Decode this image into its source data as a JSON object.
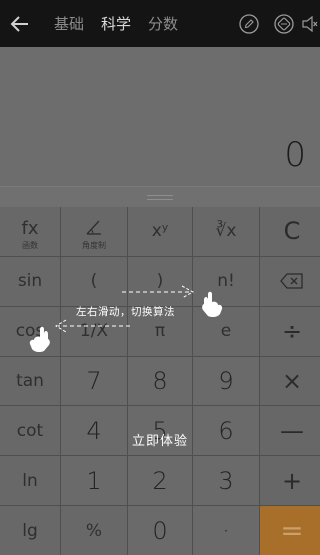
{
  "topbar": {
    "tabs": [
      {
        "label": "基础",
        "active": false
      },
      {
        "label": "科学",
        "active": true
      },
      {
        "label": "分数",
        "active": false
      }
    ],
    "icons": [
      "back-arrow-icon",
      "pencil-icon",
      "theme-icon",
      "sound-mute-icon"
    ]
  },
  "display": {
    "value": "0"
  },
  "keys": {
    "r1": [
      {
        "label": "fx",
        "sub": "函数"
      },
      {
        "label": "",
        "sub": "角度制"
      },
      {
        "label": "xʸ"
      },
      {
        "label": "∛x"
      },
      {
        "label": "C"
      }
    ],
    "r2": [
      {
        "label": "sin"
      },
      {
        "label": "("
      },
      {
        "label": ")"
      },
      {
        "label": "n!"
      },
      {
        "label": "⌫"
      }
    ],
    "r3": [
      {
        "label": "cos"
      },
      {
        "label": "1/X"
      },
      {
        "label": "π"
      },
      {
        "label": "e"
      },
      {
        "label": "÷"
      }
    ],
    "r4": [
      {
        "label": "tan"
      },
      {
        "label": "7"
      },
      {
        "label": "8"
      },
      {
        "label": "9"
      },
      {
        "label": "×"
      }
    ],
    "r5": [
      {
        "label": "cot"
      },
      {
        "label": "4"
      },
      {
        "label": "5"
      },
      {
        "label": "6"
      },
      {
        "label": "—"
      }
    ],
    "r6": [
      {
        "label": "ln"
      },
      {
        "label": "1"
      },
      {
        "label": "2"
      },
      {
        "label": "3"
      },
      {
        "label": "+"
      }
    ],
    "r7": [
      {
        "label": "lg"
      },
      {
        "label": "%"
      },
      {
        "label": "0"
      },
      {
        "label": "·"
      },
      {
        "label": "="
      }
    ]
  },
  "overlay": {
    "swipe_hint": "左右滑动，切换算法",
    "try_now": "立即体验"
  },
  "colors": {
    "accent": "#a86f2a",
    "topbar": "#141414"
  }
}
